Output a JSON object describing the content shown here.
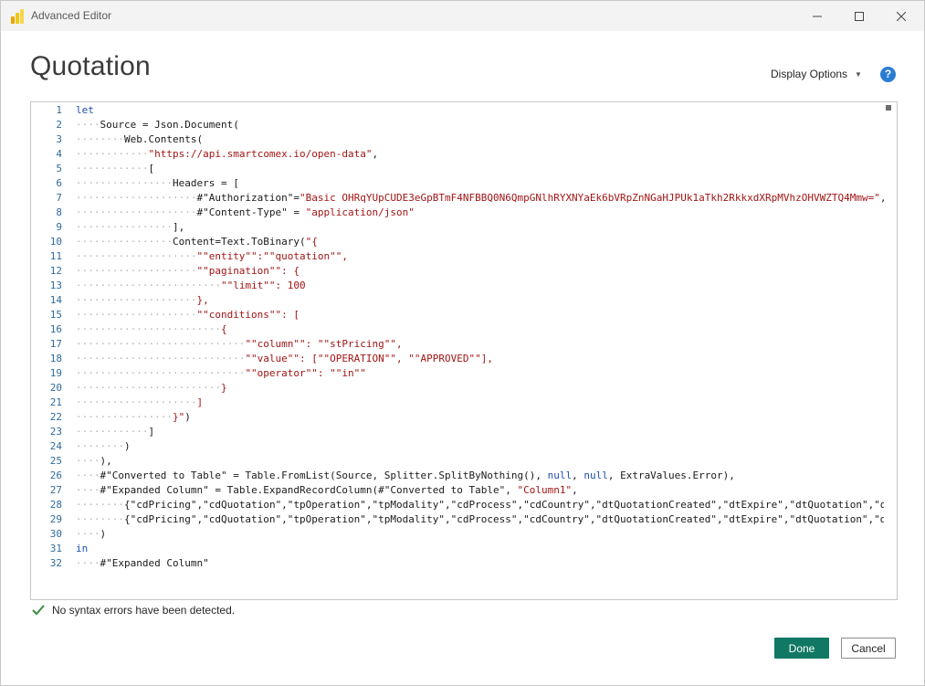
{
  "window": {
    "title": "Advanced Editor"
  },
  "header": {
    "query_name": "Quotation",
    "display_options_label": "Display Options",
    "help_icon_glyph": "?"
  },
  "editor": {
    "lines": [
      {
        "n": "1",
        "segs": [
          {
            "t": "let",
            "c": "kw"
          }
        ]
      },
      {
        "n": "2",
        "segs": [
          {
            "t": "····",
            "c": "dots"
          },
          {
            "t": "Source = Json.Document(",
            "c": ""
          }
        ]
      },
      {
        "n": "3",
        "segs": [
          {
            "t": "········",
            "c": "dots"
          },
          {
            "t": "Web.Contents(",
            "c": ""
          }
        ]
      },
      {
        "n": "4",
        "segs": [
          {
            "t": "············",
            "c": "dots"
          },
          {
            "t": "\"https://api.smartcomex.io/open-data\"",
            "c": "str"
          },
          {
            "t": ",",
            "c": ""
          }
        ]
      },
      {
        "n": "5",
        "segs": [
          {
            "t": "············",
            "c": "dots"
          },
          {
            "t": "[",
            "c": ""
          }
        ]
      },
      {
        "n": "6",
        "segs": [
          {
            "t": "················",
            "c": "dots"
          },
          {
            "t": "Headers = [",
            "c": ""
          }
        ]
      },
      {
        "n": "7",
        "segs": [
          {
            "t": "····················",
            "c": "dots"
          },
          {
            "t": "#\"Authorization\"=",
            "c": ""
          },
          {
            "t": "\"Basic OHRqYUpCUDE3eGpBTmF4NFBBQ0N6QmpGNlhRYXNYaEk6bVRpZnNGaHJPUk1aTkh2RkkxdXRpMVhzOHVWZTQ4Mmw=\"",
            "c": "str"
          },
          {
            "t": ",",
            "c": ""
          }
        ]
      },
      {
        "n": "8",
        "segs": [
          {
            "t": "····················",
            "c": "dots"
          },
          {
            "t": "#\"Content-Type\" = ",
            "c": ""
          },
          {
            "t": "\"application/json\"",
            "c": "str"
          }
        ]
      },
      {
        "n": "9",
        "segs": [
          {
            "t": "················",
            "c": "dots"
          },
          {
            "t": "],",
            "c": ""
          }
        ]
      },
      {
        "n": "10",
        "segs": [
          {
            "t": "················",
            "c": "dots"
          },
          {
            "t": "Content=Text.ToBinary(",
            "c": ""
          },
          {
            "t": "\"{",
            "c": "str"
          }
        ]
      },
      {
        "n": "11",
        "segs": [
          {
            "t": "····················",
            "c": "dots"
          },
          {
            "t": "\"\"entity\"\":\"\"quotation\"\",",
            "c": "str"
          }
        ]
      },
      {
        "n": "12",
        "segs": [
          {
            "t": "····················",
            "c": "dots"
          },
          {
            "t": "\"\"pagination\"\": {",
            "c": "str"
          }
        ]
      },
      {
        "n": "13",
        "segs": [
          {
            "t": "························",
            "c": "dots"
          },
          {
            "t": "\"\"limit\"\": 100",
            "c": "str"
          }
        ]
      },
      {
        "n": "14",
        "segs": [
          {
            "t": "····················",
            "c": "dots"
          },
          {
            "t": "},",
            "c": "str"
          }
        ]
      },
      {
        "n": "15",
        "segs": [
          {
            "t": "····················",
            "c": "dots"
          },
          {
            "t": "\"\"conditions\"\": [",
            "c": "str"
          }
        ]
      },
      {
        "n": "16",
        "segs": [
          {
            "t": "························",
            "c": "dots"
          },
          {
            "t": "{",
            "c": "str"
          }
        ]
      },
      {
        "n": "17",
        "segs": [
          {
            "t": "····························",
            "c": "dots"
          },
          {
            "t": "\"\"column\"\": \"\"stPricing\"\",",
            "c": "str"
          }
        ]
      },
      {
        "n": "18",
        "segs": [
          {
            "t": "····························",
            "c": "dots"
          },
          {
            "t": "\"\"value\"\": [\"\"OPERATION\"\", \"\"APPROVED\"\"],",
            "c": "str"
          }
        ]
      },
      {
        "n": "19",
        "segs": [
          {
            "t": "····························",
            "c": "dots"
          },
          {
            "t": "\"\"operator\"\": \"\"in\"\"",
            "c": "str"
          }
        ]
      },
      {
        "n": "20",
        "segs": [
          {
            "t": "························",
            "c": "dots"
          },
          {
            "t": "}",
            "c": "str"
          }
        ]
      },
      {
        "n": "21",
        "segs": [
          {
            "t": "····················",
            "c": "dots"
          },
          {
            "t": "]",
            "c": "str"
          }
        ]
      },
      {
        "n": "22",
        "segs": [
          {
            "t": "················",
            "c": "dots"
          },
          {
            "t": "}\"",
            "c": "str"
          },
          {
            "t": ")",
            "c": ""
          }
        ]
      },
      {
        "n": "23",
        "segs": [
          {
            "t": "············",
            "c": "dots"
          },
          {
            "t": "]",
            "c": ""
          }
        ]
      },
      {
        "n": "24",
        "segs": [
          {
            "t": "········",
            "c": "dots"
          },
          {
            "t": ")",
            "c": ""
          }
        ]
      },
      {
        "n": "25",
        "segs": [
          {
            "t": "····",
            "c": "dots"
          },
          {
            "t": "),",
            "c": ""
          }
        ]
      },
      {
        "n": "26",
        "segs": [
          {
            "t": "····",
            "c": "dots"
          },
          {
            "t": "#\"Converted to Table\" = Table.FromList(Source, Splitter.SplitByNothing(), ",
            "c": ""
          },
          {
            "t": "null",
            "c": "kw"
          },
          {
            "t": ", ",
            "c": ""
          },
          {
            "t": "null",
            "c": "kw"
          },
          {
            "t": ", ExtraValues.Error),",
            "c": ""
          }
        ]
      },
      {
        "n": "27",
        "segs": [
          {
            "t": "····",
            "c": "dots"
          },
          {
            "t": "#\"Expanded Column\" = Table.ExpandRecordColumn(#\"Converted to Table\", ",
            "c": ""
          },
          {
            "t": "\"Column1\"",
            "c": "str"
          },
          {
            "t": ",",
            "c": ""
          }
        ]
      },
      {
        "n": "28",
        "segs": [
          {
            "t": "········",
            "c": "dots"
          },
          {
            "t": "{",
            "c": ""
          },
          {
            "t": "\"cdPricing\"",
            "c": ""
          },
          {
            "t": ",",
            "c": ""
          },
          {
            "t": "\"cdQuotation\",\"tpOperation\",\"tpModality\",\"cdProcess\",\"cdCountry\",\"dtQuotationCreated\",\"dtExpire\",\"dtQuotation\",\"dtP",
            "c": ""
          }
        ]
      },
      {
        "n": "29",
        "segs": [
          {
            "t": "········",
            "c": "dots"
          },
          {
            "t": "{\"cdPricing\",\"cdQuotation\",\"tpOperation\",\"tpModality\",\"cdProcess\",\"cdCountry\",\"dtQuotationCreated\",\"dtExpire\",\"dtQuotation\",\"dtP",
            "c": ""
          }
        ]
      },
      {
        "n": "30",
        "segs": [
          {
            "t": "····",
            "c": "dots"
          },
          {
            "t": ")",
            "c": ""
          }
        ]
      },
      {
        "n": "31",
        "segs": [
          {
            "t": "in",
            "c": "kw"
          }
        ]
      },
      {
        "n": "32",
        "segs": [
          {
            "t": "····",
            "c": "dots"
          },
          {
            "t": "#\"Expanded Column\"",
            "c": ""
          }
        ]
      }
    ]
  },
  "status": {
    "message": "No syntax errors have been detected."
  },
  "footer": {
    "done_label": "Done",
    "cancel_label": "Cancel"
  },
  "colors": {
    "accent": "#117865",
    "keyword": "#1e4fb0",
    "string": "#a31515",
    "line_number": "#2f6b9c",
    "success": "#3c8a3c"
  }
}
